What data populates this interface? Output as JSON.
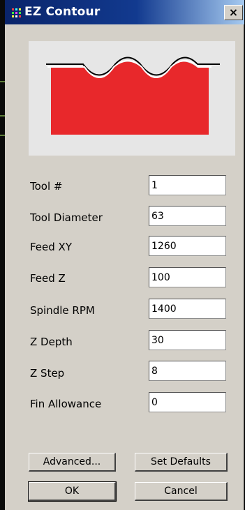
{
  "window": {
    "title": "EZ Contour",
    "close_label": "×"
  },
  "preview": {
    "shape_color": "#e8282b",
    "background_color": "#e6e6e6"
  },
  "form": {
    "fields": [
      {
        "label": "Tool #",
        "value": "1"
      },
      {
        "label": "Tool Diameter",
        "value": "63"
      },
      {
        "label": "Feed XY",
        "value": "1260"
      },
      {
        "label": "Feed Z",
        "value": "100"
      },
      {
        "label": "Spindle RPM",
        "value": "1400"
      },
      {
        "label": "Z Depth",
        "value": "30"
      },
      {
        "label": "Z Step",
        "value": "8"
      },
      {
        "label": "Fin Allowance",
        "value": "0"
      }
    ]
  },
  "buttons": {
    "advanced": "Advanced...",
    "set_defaults": "Set Defaults",
    "ok": "OK",
    "cancel": "Cancel"
  },
  "colors": {
    "titlebar_start": "#0a246a",
    "titlebar_end": "#a6caf0",
    "face": "#d4d0c8"
  }
}
